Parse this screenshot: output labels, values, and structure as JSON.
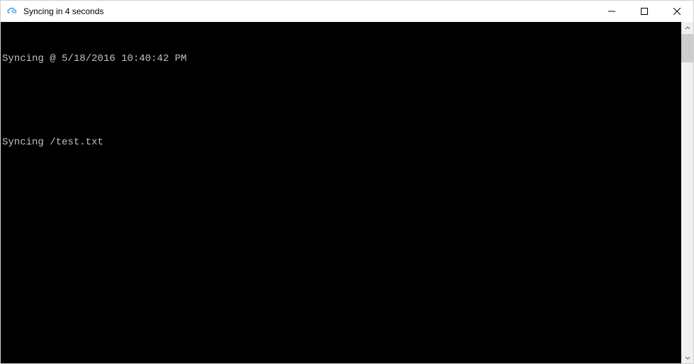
{
  "window": {
    "title": "Syncing in 4 seconds"
  },
  "terminal": {
    "lines": [
      "Syncing @ 5/18/2016 10:40:42 PM",
      "",
      "Syncing /test.txt"
    ]
  }
}
